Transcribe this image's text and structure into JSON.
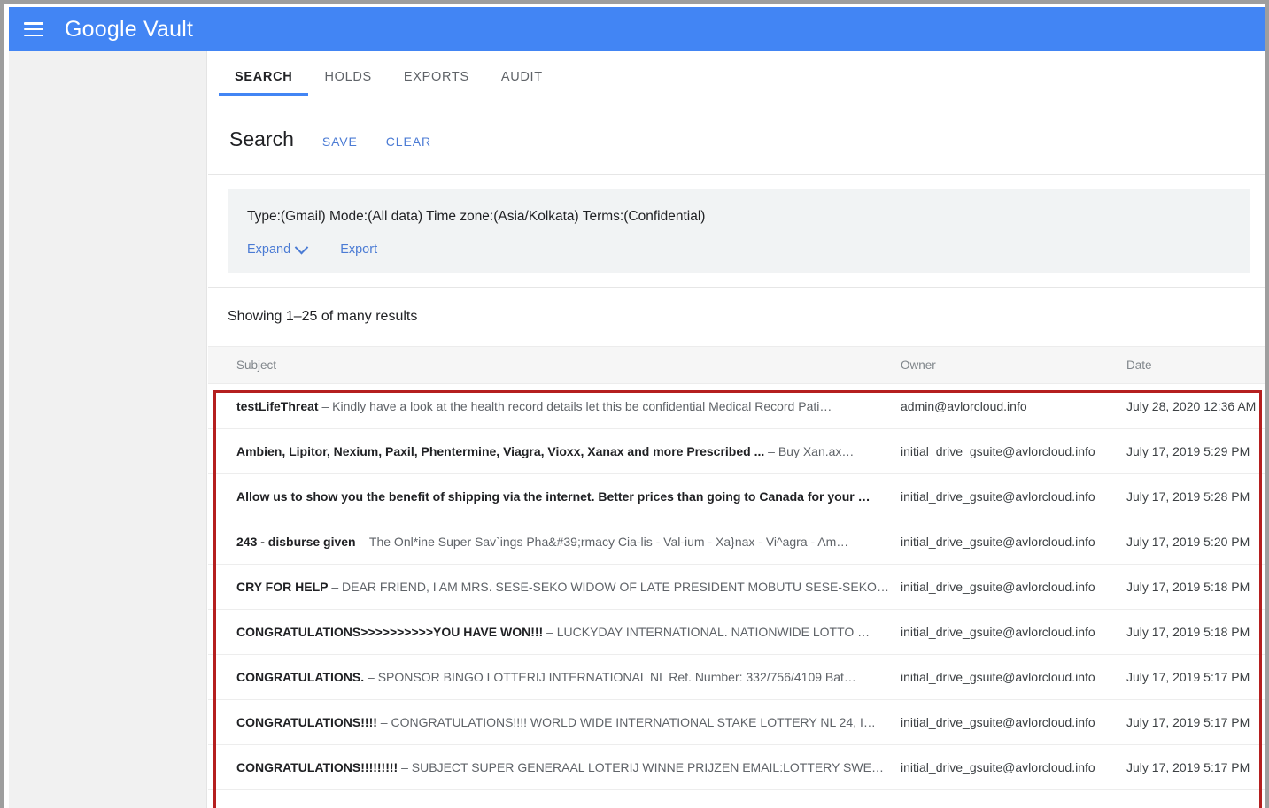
{
  "appbar": {
    "menu_icon": "hamburger-menu-icon",
    "title": "Google Vault"
  },
  "tabs": [
    {
      "label": "SEARCH",
      "active": true
    },
    {
      "label": "HOLDS",
      "active": false
    },
    {
      "label": "EXPORTS",
      "active": false
    },
    {
      "label": "AUDIT",
      "active": false
    }
  ],
  "search": {
    "title": "Search",
    "save_label": "SAVE",
    "clear_label": "CLEAR",
    "query_summary": "Type:(Gmail) Mode:(All data) Time zone:(Asia/Kolkata) Terms:(Confidential)",
    "expand_label": "Expand",
    "expand_icon": "chevron-down-icon",
    "export_label": "Export"
  },
  "results": {
    "count_text": "Showing 1–25 of many results",
    "columns": [
      "Subject",
      "Owner",
      "Date"
    ],
    "rows": [
      {
        "subject_bold": "testLifeThreat",
        "subject_sep": " – ",
        "subject_rest": "Kindly have a look at the health record details let this be confidential Medical Record Pati…",
        "owner": "admin@avlorcloud.info",
        "date": "July 28, 2020 12:36 AM"
      },
      {
        "subject_bold": "Ambien, Lipitor, Nexium, Paxil, Phentermine, Viagra, Vioxx, Xanax and more Prescribed ...",
        "subject_sep": " – ",
        "subject_rest": "Buy Xan.ax…",
        "owner": "initial_drive_gsuite@avlorcloud.info",
        "date": "July 17, 2019 5:29 PM"
      },
      {
        "subject_bold": "Allow us to show you the benefit of shipping via the internet. Better prices than going to Canada for your …",
        "subject_sep": "",
        "subject_rest": "",
        "owner": "initial_drive_gsuite@avlorcloud.info",
        "date": "July 17, 2019 5:28 PM"
      },
      {
        "subject_bold": "243 - disburse given",
        "subject_sep": " – ",
        "subject_rest": "The Onl*ine Super Sav`ings Pha&#39;rmacy Cia-lis - Val-ium - Xa}nax - Vi^agra - Am…",
        "owner": "initial_drive_gsuite@avlorcloud.info",
        "date": "July 17, 2019 5:20 PM"
      },
      {
        "subject_bold": "CRY FOR HELP",
        "subject_sep": " – ",
        "subject_rest": "DEAR FRIEND, I AM MRS. SESE-SEKO WIDOW OF LATE PRESIDENT MOBUTU SESE-SEKO…",
        "owner": "initial_drive_gsuite@avlorcloud.info",
        "date": "July 17, 2019 5:18 PM"
      },
      {
        "subject_bold": "CONGRATULATIONS>>>>>>>>>>YOU HAVE WON!!!",
        "subject_sep": " – ",
        "subject_rest": "LUCKYDAY INTERNATIONAL. NATIONWIDE LOTTO …",
        "owner": "initial_drive_gsuite@avlorcloud.info",
        "date": "July 17, 2019 5:18 PM"
      },
      {
        "subject_bold": "CONGRATULATIONS.",
        "subject_sep": " – ",
        "subject_rest": "SPONSOR BINGO LOTTERIJ INTERNATIONAL NL Ref. Number: 332/756/4109 Bat…",
        "owner": "initial_drive_gsuite@avlorcloud.info",
        "date": "July 17, 2019 5:17 PM"
      },
      {
        "subject_bold": "CONGRATULATIONS!!!!",
        "subject_sep": " – ",
        "subject_rest": "CONGRATULATIONS!!!! WORLD WIDE INTERNATIONAL STAKE LOTTERY NL 24, I…",
        "owner": "initial_drive_gsuite@avlorcloud.info",
        "date": "July 17, 2019 5:17 PM"
      },
      {
        "subject_bold": "CONGRATULATIONS!!!!!!!!!",
        "subject_sep": " – ",
        "subject_rest": "SUBJECT SUPER GENERAAL LOTERIJ WINNE PRIJZEN EMAIL:LOTTERY SWE…",
        "owner": "initial_drive_gsuite@avlorcloud.info",
        "date": "July 17, 2019 5:17 PM"
      }
    ]
  },
  "annotation": {
    "highlight_color": "#b51f1f"
  },
  "colors": {
    "brand_blue": "#4285f4",
    "link_blue": "#4b7bd4",
    "panel_gray": "#f1f3f4",
    "rail_gray": "#f1f1f1"
  }
}
